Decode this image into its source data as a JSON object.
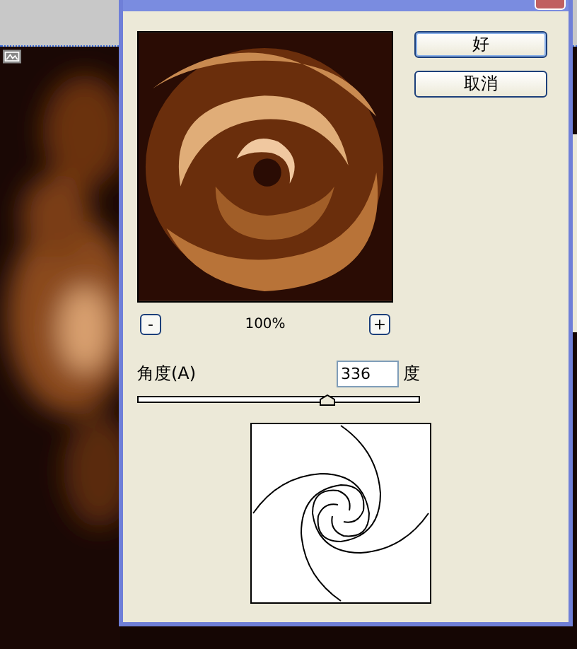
{
  "buttons": [
    "好",
    "取消"
  ],
  "zoom": {
    "minus": "-",
    "value": "100%",
    "plus": "+"
  },
  "angle": {
    "label": "角度(A)",
    "value": "336",
    "unit": "度",
    "level": 0.67
  }
}
